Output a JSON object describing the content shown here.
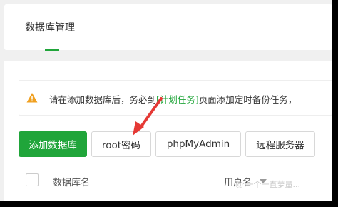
{
  "tabs": [
    {
      "label": "数据库管理",
      "active": true
    }
  ],
  "alert": {
    "prefix": "请在添加数据库后，务必到",
    "link": "[计划任务]",
    "suffix": "页面添加定时备份任务，"
  },
  "toolbar": {
    "add_database": "添加数据库",
    "root_password": "root密码",
    "phpmyadmin": "phpMyAdmin",
    "remote_server": "远程服务器"
  },
  "table": {
    "columns": [
      "数据库名",
      "用户名"
    ]
  },
  "watermark": "@ 一个一直萝量...",
  "colors": {
    "accent": "#20a53a",
    "warning": "#f0a020",
    "annotation": "#e53935"
  },
  "icons": [
    "warning-icon",
    "sort-down-icon",
    "annotation-arrow"
  ]
}
